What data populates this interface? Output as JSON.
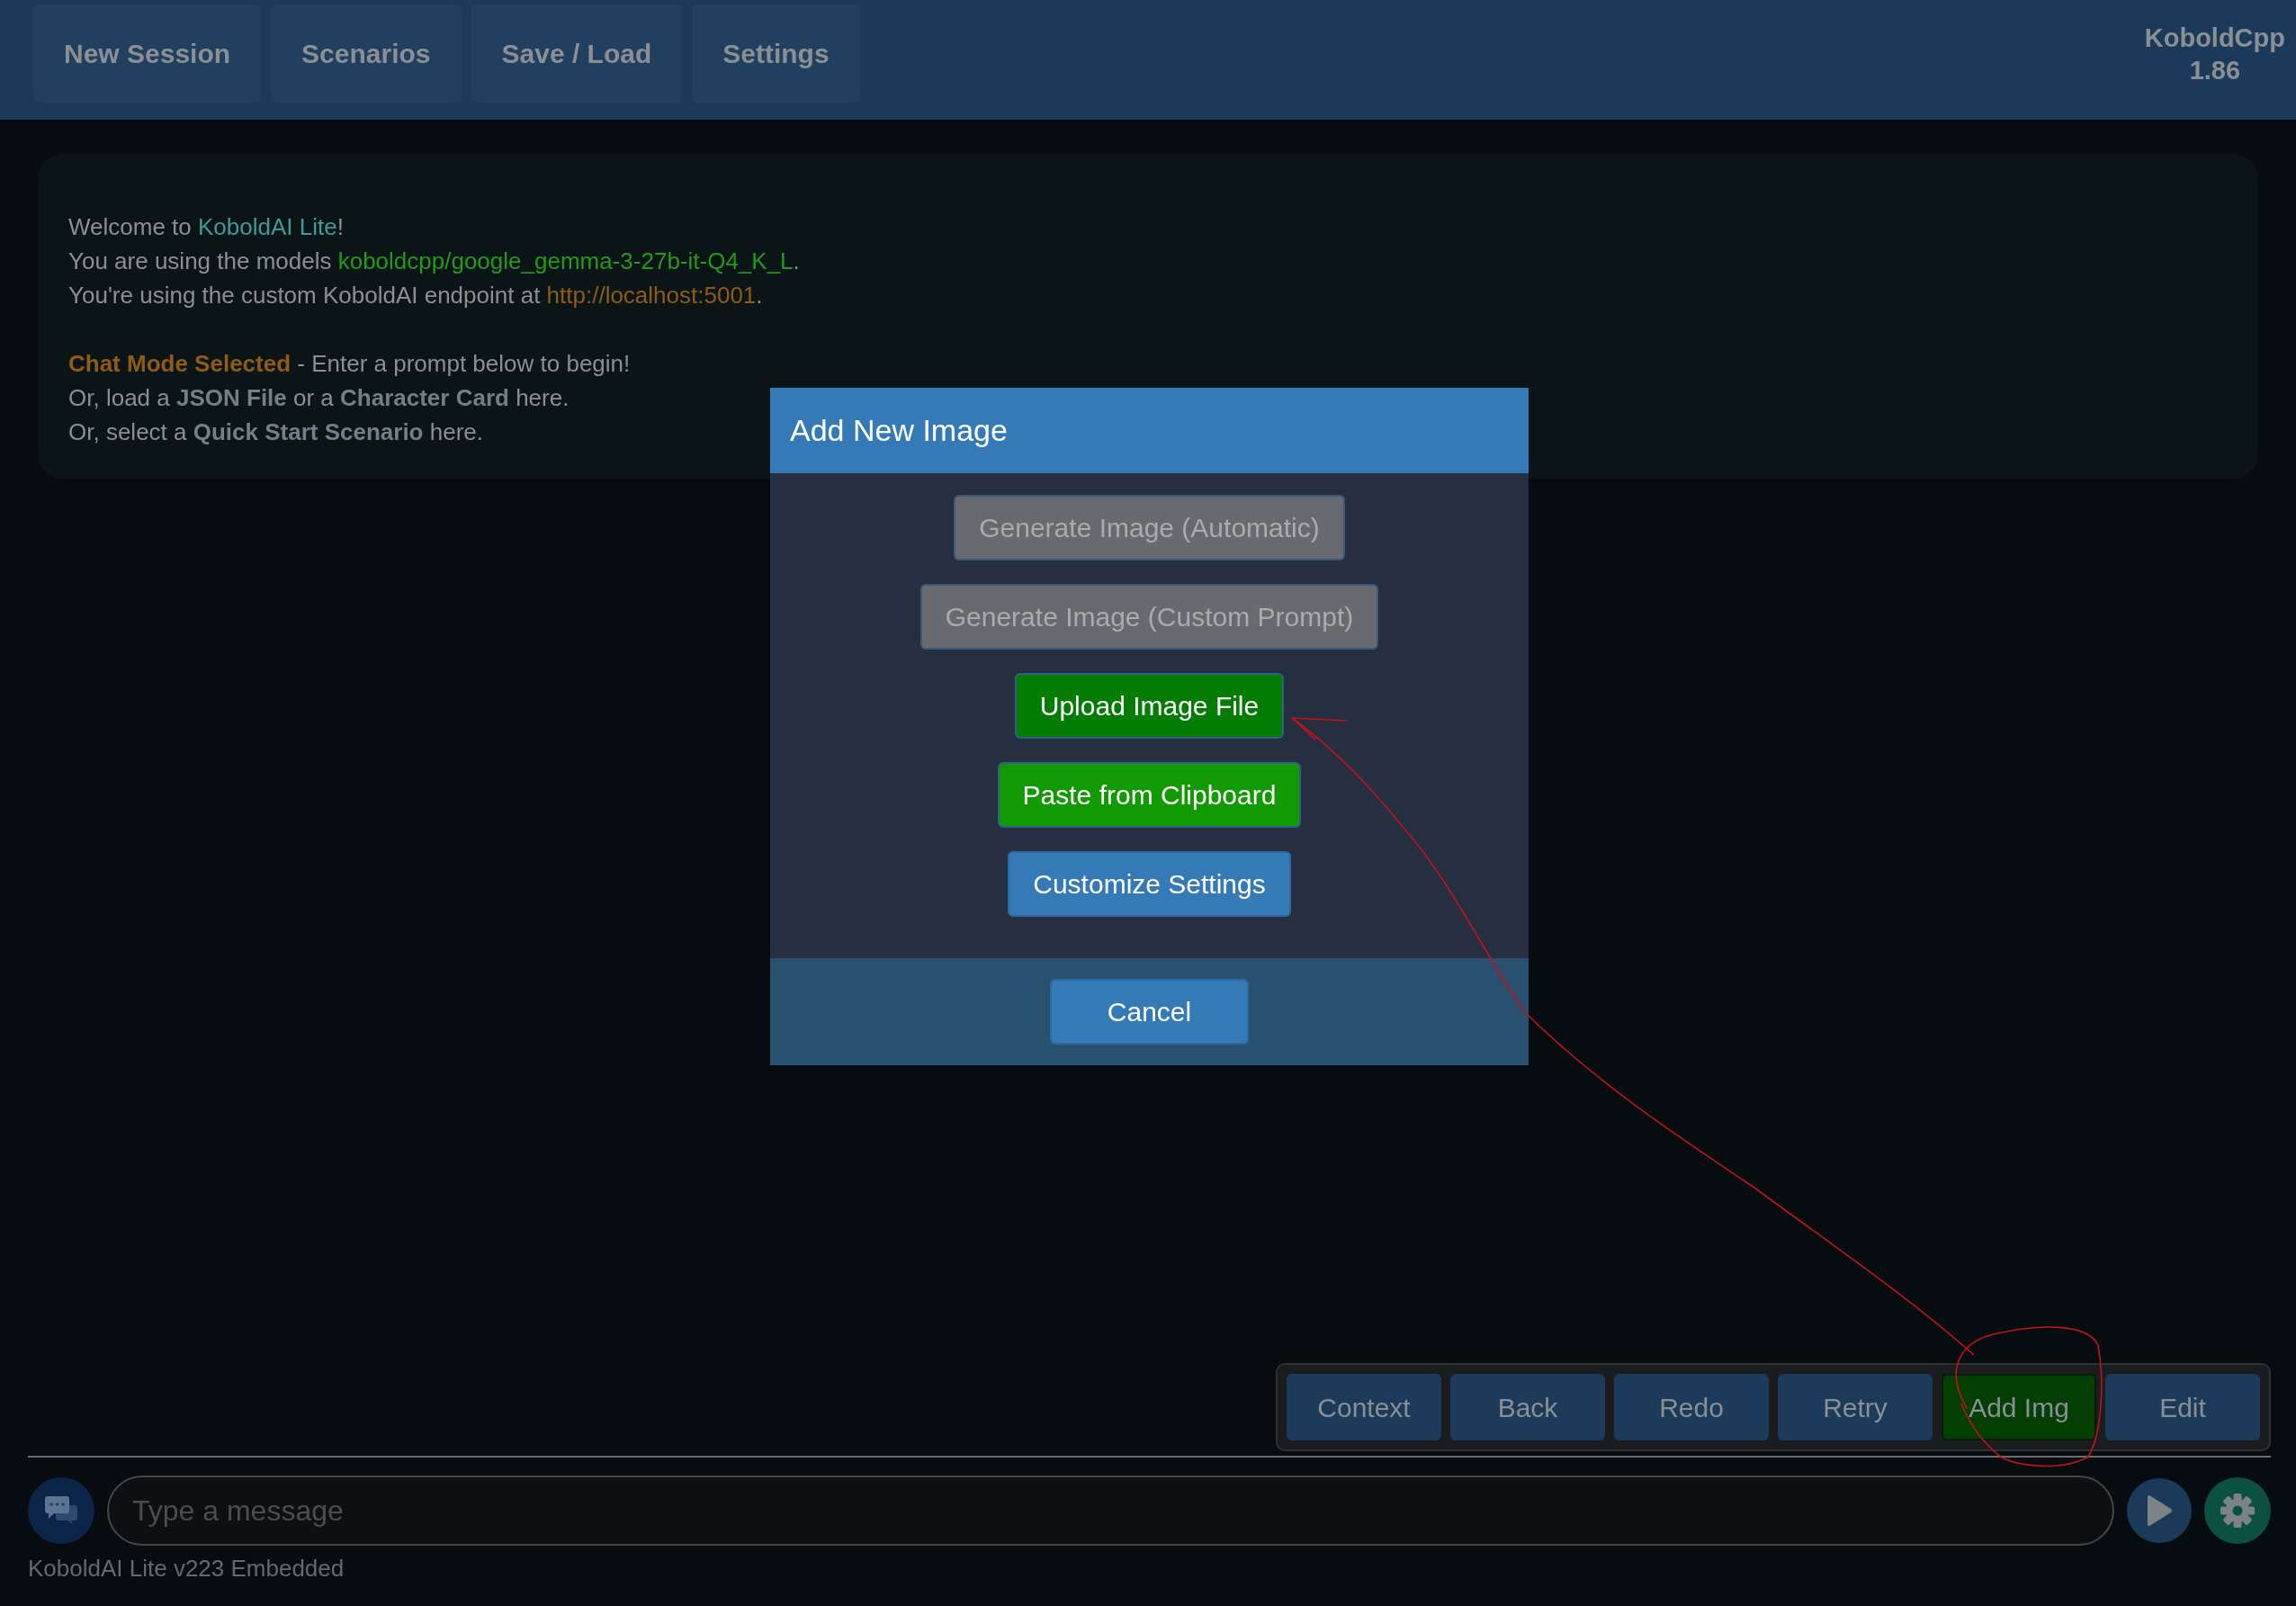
{
  "top_nav": {
    "tabs": [
      {
        "label": "New Session"
      },
      {
        "label": "Scenarios"
      },
      {
        "label": "Save / Load"
      },
      {
        "label": "Settings"
      }
    ],
    "app_name": "KoboldCpp",
    "app_version": "1.86"
  },
  "welcome": {
    "paragraphs": [
      [
        [
          {
            "kind": "plain",
            "text": "Welcome to "
          },
          {
            "kind": "teal",
            "text": "KoboldAI Lite"
          },
          {
            "kind": "plain",
            "text": "!"
          }
        ],
        [
          {
            "kind": "plain",
            "text": "You are using the models "
          },
          {
            "kind": "green",
            "text": "koboldcpp/google_gemma-3-27b-it-Q4_K_L"
          },
          {
            "kind": "plain",
            "text": "."
          }
        ],
        [
          {
            "kind": "plain",
            "text": "You're using the custom KoboldAI endpoint at "
          },
          {
            "kind": "orange",
            "text": "http://localhost:5001"
          },
          {
            "kind": "plain",
            "text": "."
          }
        ]
      ],
      [
        [
          {
            "kind": "mode",
            "text": "Chat Mode Selected"
          },
          {
            "kind": "plain",
            "text": " - Enter a prompt below to begin!"
          }
        ],
        [
          {
            "kind": "plain",
            "text": "Or, load a "
          },
          {
            "kind": "bold",
            "text": "JSON File"
          },
          {
            "kind": "plain",
            "text": " or a "
          },
          {
            "kind": "bold",
            "text": "Character Card"
          },
          {
            "kind": "plain",
            "text": " here."
          }
        ],
        [
          {
            "kind": "plain",
            "text": "Or, select a "
          },
          {
            "kind": "bold",
            "text": "Quick Start Scenario"
          },
          {
            "kind": "plain",
            "text": " here."
          }
        ]
      ]
    ]
  },
  "dialog": {
    "title": "Add New Image",
    "buttons": [
      {
        "label": "Generate Image (Automatic)",
        "kind": "default",
        "disabled": true,
        "hovered": false
      },
      {
        "label": "Generate Image (Custom Prompt)",
        "kind": "default",
        "disabled": true,
        "hovered": false
      },
      {
        "label": "Upload Image File",
        "kind": "success",
        "disabled": false,
        "hovered": true
      },
      {
        "label": "Paste from Clipboard",
        "kind": "success",
        "disabled": false,
        "hovered": false
      },
      {
        "label": "Customize Settings",
        "kind": "primary",
        "disabled": false,
        "hovered": false
      }
    ],
    "cancel": "Cancel"
  },
  "action_bar": {
    "buttons": [
      {
        "label": "Context",
        "active": false
      },
      {
        "label": "Back",
        "active": false
      },
      {
        "label": "Redo",
        "active": false
      },
      {
        "label": "Retry",
        "active": false
      },
      {
        "label": "Add Img",
        "active": true
      },
      {
        "label": "Edit",
        "active": false
      }
    ]
  },
  "input": {
    "placeholder": "Type a message"
  },
  "footer": "KoboldAI Lite v223 Embedded"
}
